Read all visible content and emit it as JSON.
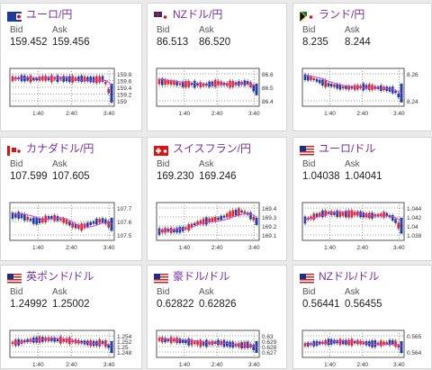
{
  "labels": {
    "bid": "Bid",
    "ask": "Ask"
  },
  "colors": {
    "title": "#7a2fa0",
    "up": "#e8242b",
    "down": "#1f3fa8",
    "ma": "#d23fd6"
  },
  "cards": [
    {
      "title": "ユーロ/円",
      "flag": "eu",
      "bid": "159.452",
      "ask": "159.456",
      "ticks": [
        "159.8",
        "159.6",
        "159.4",
        "159.2",
        "159"
      ],
      "x": [
        "1:40",
        "2:40",
        "3:40"
      ],
      "trend": [
        0.8,
        0.82,
        0.8,
        0.78,
        0.82,
        0.8,
        0.8,
        0.79,
        0.78,
        0.8,
        0.78,
        0.76,
        0.8,
        0.1
      ]
    },
    {
      "title": "NZドル/円",
      "flag": "nz",
      "bid": "86.513",
      "ask": "86.520",
      "ticks": [
        "86.6",
        "86.5",
        "86.4"
      ],
      "x": [
        "1:40",
        "2:40",
        "3:40"
      ],
      "trend": [
        0.7,
        0.68,
        0.65,
        0.6,
        0.62,
        0.6,
        0.58,
        0.62,
        0.65,
        0.6,
        0.62,
        0.64,
        0.66,
        0.35
      ]
    },
    {
      "title": "ランド/円",
      "flag": "za",
      "bid": "8.235",
      "ask": "8.244",
      "ticks": [
        "8.26",
        "8.24"
      ],
      "x": [
        "1:40",
        "2:40",
        "3:40"
      ],
      "trend": [
        0.85,
        0.8,
        0.7,
        0.6,
        0.55,
        0.5,
        0.48,
        0.5,
        0.52,
        0.5,
        0.48,
        0.45,
        0.4,
        0.1
      ]
    },
    {
      "title": "カナダドル/円",
      "flag": "ca",
      "bid": "107.599",
      "ask": "107.605",
      "ticks": [
        "107.7",
        "107.6",
        "107.5"
      ],
      "x": [
        "1:40",
        "2:40",
        "3:40"
      ],
      "trend": [
        0.7,
        0.72,
        0.6,
        0.5,
        0.55,
        0.65,
        0.6,
        0.5,
        0.35,
        0.3,
        0.4,
        0.5,
        0.55,
        0.3
      ]
    },
    {
      "title": "スイスフラン/円",
      "flag": "ch",
      "bid": "169.230",
      "ask": "169.246",
      "ticks": [
        "169.4",
        "169.3",
        "169.2",
        "169.1"
      ],
      "x": [
        "1:40",
        "2:40",
        "3:40"
      ],
      "trend": [
        0.15,
        0.2,
        0.18,
        0.22,
        0.3,
        0.45,
        0.5,
        0.55,
        0.6,
        0.7,
        0.8,
        0.85,
        0.75,
        0.5
      ]
    },
    {
      "title": "ユーロ/ドル",
      "flag": "us",
      "bid": "1.04038",
      "ask": "1.04041",
      "ticks": [
        "1.044",
        "1.042",
        "1.04",
        "1.038"
      ],
      "x": [
        "1:40",
        "2:40",
        "3:40"
      ],
      "trend": [
        0.55,
        0.65,
        0.75,
        0.8,
        0.78,
        0.75,
        0.76,
        0.78,
        0.72,
        0.7,
        0.72,
        0.74,
        0.6,
        0.2
      ]
    },
    {
      "title": "英ポンド/ドル",
      "flag": "us",
      "bid": "1.24992",
      "ask": "1.25002",
      "ticks": [
        "1.254",
        "1.252",
        "1.25",
        "1.248"
      ],
      "x": [
        "1:40",
        "2:40",
        "3:40"
      ],
      "trend": [
        0.55,
        0.6,
        0.68,
        0.72,
        0.75,
        0.76,
        0.72,
        0.7,
        0.65,
        0.6,
        0.55,
        0.52,
        0.6,
        0.2
      ]
    },
    {
      "title": "豪ドル/ドル",
      "flag": "us",
      "bid": "0.62822",
      "ask": "0.62826",
      "ticks": [
        "0.63",
        "0.629",
        "0.628",
        "0.627"
      ],
      "x": [
        "1:40",
        "2:40",
        "3:40"
      ],
      "trend": [
        0.75,
        0.7,
        0.72,
        0.65,
        0.6,
        0.55,
        0.52,
        0.55,
        0.58,
        0.5,
        0.45,
        0.42,
        0.45,
        0.2
      ]
    },
    {
      "title": "NZドル/ドル",
      "flag": "us",
      "bid": "0.56441",
      "ask": "0.56455",
      "ticks": [
        "0.565",
        "0.564"
      ],
      "x": [
        "1:40",
        "2:40",
        "3:40"
      ],
      "trend": [
        0.45,
        0.5,
        0.55,
        0.6,
        0.62,
        0.6,
        0.58,
        0.6,
        0.55,
        0.5,
        0.52,
        0.55,
        0.6,
        0.2
      ]
    }
  ]
}
